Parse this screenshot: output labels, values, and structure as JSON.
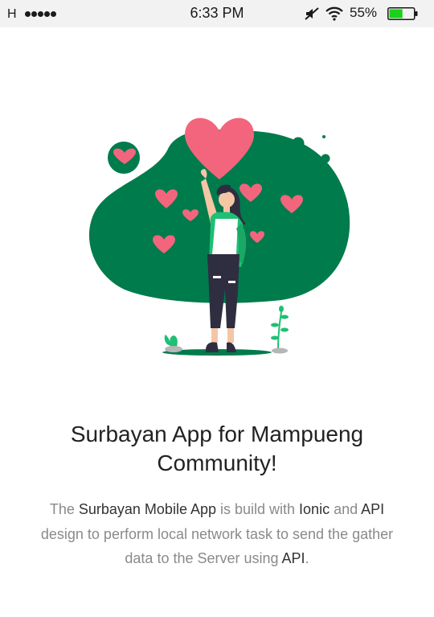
{
  "status_bar": {
    "carrier": "H",
    "time": "6:33 PM",
    "battery_percent": "55%",
    "battery_level": 0.55,
    "icons": [
      "signal-dots-icon",
      "mute-icon",
      "wifi-icon",
      "battery-icon"
    ]
  },
  "hero": {
    "illustration": "woman-with-hearts-illustration"
  },
  "intro": {
    "headline": "Surbayan App for Mampueng Community!",
    "description_parts": {
      "p1": "The ",
      "app_name": "Surbayan Mobile App",
      "p2": " is build with ",
      "framework": "Ionic",
      "p3": " and ",
      "api1": "API",
      "p4": " design to perform local network task to send the gather data to the Server using ",
      "api2": "API",
      "p5": "."
    }
  },
  "colors": {
    "accent_green": "#007b4c",
    "leaf_green": "#1fbf74",
    "heart_pink": "#f2657d",
    "status_bar_bg": "#f2f2f2",
    "battery_green": "#19d219"
  }
}
